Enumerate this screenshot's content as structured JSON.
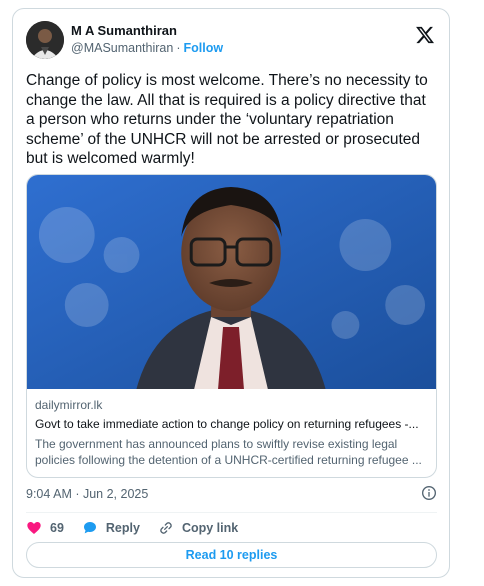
{
  "author": {
    "name": "M A Sumanthiran",
    "handle": "@MASumanthiran",
    "separator": "·",
    "follow_label": "Follow"
  },
  "tweet": {
    "text": "Change of policy is most welcome. There’s no necessity to change the law. All that is required is a policy directive that a person who returns under the ‘voluntary repatriation scheme’ of the UNHCR will not be arrested or prosecuted but is welcomed warmly!"
  },
  "link_card": {
    "domain": "dailymirror.lk",
    "title": "Govt to take immediate action to change policy on returning refugees -...",
    "description": "The government has announced plans to swiftly revise existing legal policies following the detention of a UNHCR-certified returning refugee ..."
  },
  "timestamp": "9:04 AM · Jun 2, 2025",
  "actions": {
    "likes_count": "69",
    "reply_label": "Reply",
    "copy_link_label": "Copy link"
  },
  "read_replies_label": "Read 10 replies",
  "icons": {
    "logo": "x-logo-icon",
    "info": "info-icon",
    "like": "heart-icon",
    "reply": "speech-bubble-icon",
    "copy": "link-icon"
  },
  "colors": {
    "accent": "#1d9bf0",
    "like": "#f91880",
    "text": "#0f1419",
    "secondary": "#536471"
  }
}
